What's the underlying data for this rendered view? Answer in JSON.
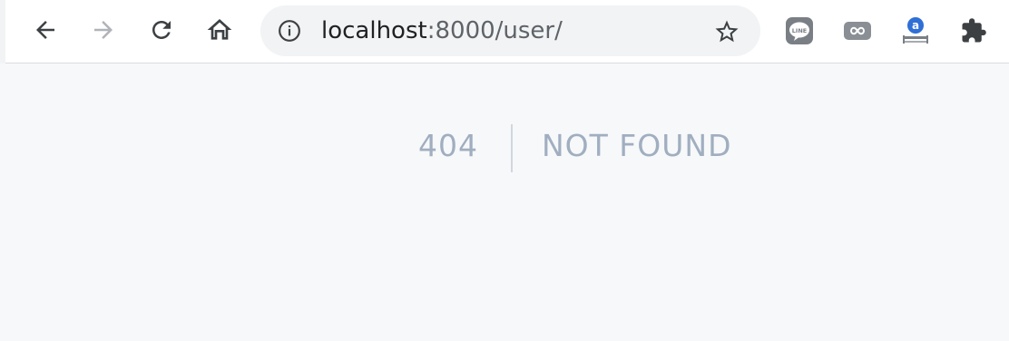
{
  "browser": {
    "url_host": "localhost",
    "url_rest": ":8000/user/",
    "icons": {
      "back": "back-arrow-icon",
      "forward": "forward-arrow-icon",
      "reload": "reload-icon",
      "home": "home-icon",
      "info": "info-icon",
      "bookmark": "star-icon",
      "extensions": [
        "line-extension-icon",
        "infinity-extension-icon",
        "translate-extension-icon",
        "puzzle-extensions-icon"
      ]
    },
    "ext_line_label": "LINE"
  },
  "error": {
    "code": "404",
    "message": "NOT FOUND"
  },
  "colors": {
    "error_text": "#a0aec0",
    "page_background": "#f7f8fa"
  }
}
